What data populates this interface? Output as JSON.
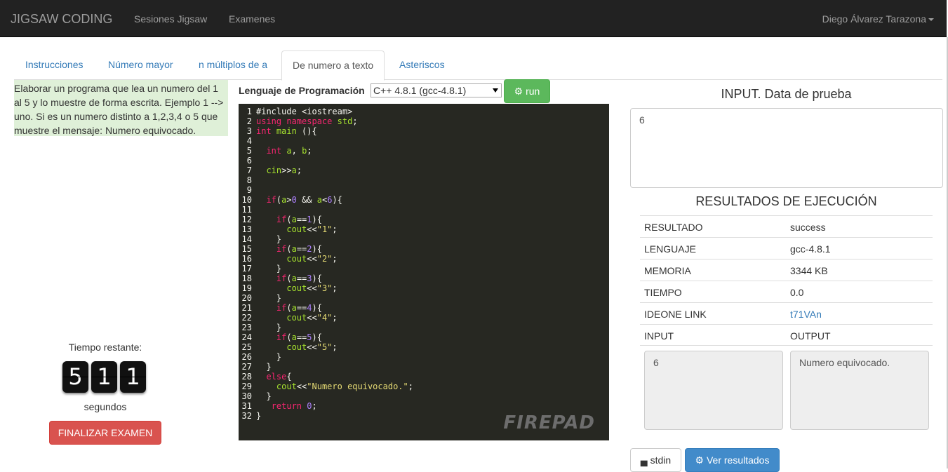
{
  "navbar": {
    "brand": "JIGSAW CODING",
    "links": [
      "Sesiones Jigsaw",
      "Examenes"
    ],
    "user": "Diego Álvarez Tarazona"
  },
  "tabs": [
    "Instrucciones",
    "Número mayor",
    "n múltiplos de a",
    "De numero a texto",
    "Asteriscos"
  ],
  "active_tab": "De numero a texto",
  "instructions": "Elaborar un programa que lea un numero del 1 al 5 y lo muestre de forma escrita. Ejemplo 1 --> uno. Si es un numero distinto a 1,2,3,4 o 5 que muestre el mensaje: Numero equivocado.",
  "timer": {
    "label": "Tiempo restante:",
    "digits": [
      "5",
      "1",
      "1"
    ],
    "unit": "segundos",
    "finish_button": "FINALIZAR EXAMEN"
  },
  "editor": {
    "lang_label": "Lenguaje de Programación",
    "lang_selected": "C++ 4.8.1 (gcc-4.8.1)",
    "run_label": "run",
    "watermark": "FIREPAD",
    "code": [
      "#include <iostream>",
      "using namespace std;",
      "int main (){",
      "",
      "  int a, b;",
      "",
      "  cin>>a;",
      "",
      "",
      "  if(a>0 && a<6){",
      "",
      "    if(a==1){",
      "      cout<<\"1\";",
      "    }",
      "    if(a==2){",
      "      cout<<\"2\";",
      "    }",
      "    if(a==3){",
      "      cout<<\"3\";",
      "    }",
      "    if(a==4){",
      "      cout<<\"4\";",
      "    }",
      "    if(a==5){",
      "      cout<<\"5\";",
      "    }",
      "  }",
      "  else{",
      "    cout<<\"Numero equivocado.\";",
      "  }",
      "   return 0;",
      "}"
    ]
  },
  "input_panel": {
    "title": "INPUT. Data de prueba",
    "value": "6"
  },
  "results": {
    "title": "RESULTADOS DE EJECUCIÓN",
    "rows": [
      {
        "key": "RESULTADO",
        "value": "success"
      },
      {
        "key": "LENGUAJE",
        "value": "gcc-4.8.1"
      },
      {
        "key": "MEMORIA",
        "value": "3344 KB"
      },
      {
        "key": "TIEMPO",
        "value": "0.0"
      },
      {
        "key": "IDEONE LINK",
        "value": "t71VAn"
      },
      {
        "key": "INPUT",
        "value": "OUTPUT"
      }
    ],
    "input_value": "6",
    "output_value": "Numero equivocado."
  },
  "buttons": {
    "stdin": "stdin",
    "ver_resultados": "Ver resultados"
  }
}
